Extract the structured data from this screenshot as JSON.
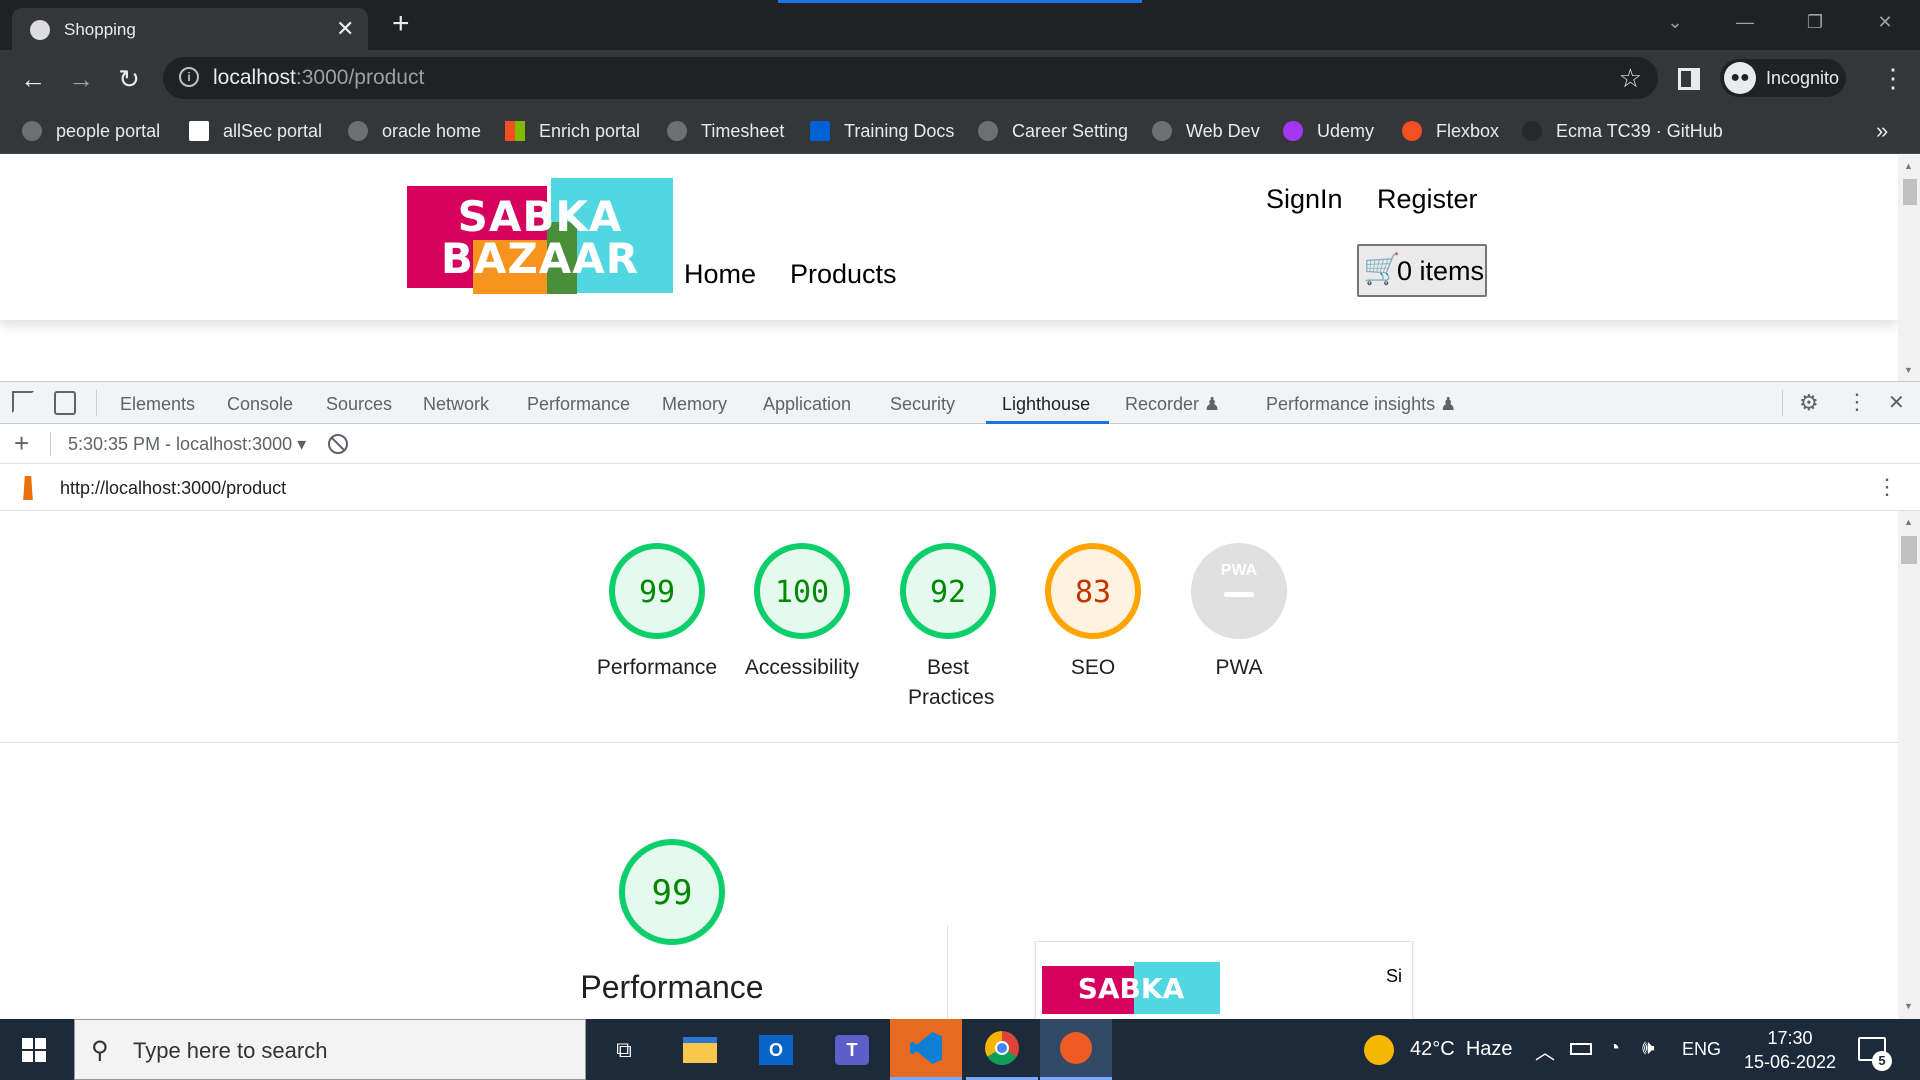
{
  "browser": {
    "tab_title": "Shopping",
    "url_host": "localhost",
    "url_path": ":3000/product",
    "profile_label": "Incognito",
    "bookmarks": [
      {
        "label": "people portal",
        "color": "#6e6f72"
      },
      {
        "label": "allSec portal",
        "color": "#ffffff"
      },
      {
        "label": "oracle home",
        "color": "#6e6f72"
      },
      {
        "label": "Enrich portal",
        "color": "#f25022"
      },
      {
        "label": "Timesheet",
        "color": "#6e6f72"
      },
      {
        "label": "Training Docs",
        "color": "#0061d5"
      },
      {
        "label": "Career Setting",
        "color": "#6e6f72"
      },
      {
        "label": "Web Dev",
        "color": "#6e6f72"
      },
      {
        "label": "Udemy",
        "color": "#a435f0"
      },
      {
        "label": "Flexbox",
        "color": "#f25022"
      },
      {
        "label": "Ecma TC39 · GitHub",
        "color": "#24292e"
      }
    ]
  },
  "site": {
    "logo_line1": "SABKA",
    "logo_line2": "BAZAAR",
    "nav_home": "Home",
    "nav_products": "Products",
    "signin": "SignIn",
    "register": "Register",
    "cart_label": "0 items",
    "colors": {
      "pink": "#d6005d",
      "orange": "#f7941e",
      "cyan": "#51d7e2",
      "green": "#4a8e3a",
      "cart": "#c8102e"
    }
  },
  "devtools": {
    "tabs": [
      {
        "label": "Elements"
      },
      {
        "label": "Console"
      },
      {
        "label": "Sources"
      },
      {
        "label": "Network"
      },
      {
        "label": "Performance"
      },
      {
        "label": "Memory"
      },
      {
        "label": "Application"
      },
      {
        "label": "Security"
      },
      {
        "label": "Lighthouse",
        "active": true
      },
      {
        "label": "Recorder"
      },
      {
        "label": "Performance insights"
      }
    ],
    "report_selector": "5:30:35 PM - localhost:3000",
    "report_url": "http://localhost:3000/product"
  },
  "lighthouse": {
    "scores": [
      {
        "label": "Performance",
        "value": 99,
        "status": "pass"
      },
      {
        "label": "Accessibility",
        "value": 100,
        "status": "pass"
      },
      {
        "label": "Best Practices",
        "value": 92,
        "status": "pass"
      },
      {
        "label": "SEO",
        "value": 83,
        "status": "average"
      },
      {
        "label": "PWA",
        "value": null,
        "status": "na"
      }
    ],
    "pwa_badge": "PWA",
    "main_score": 99,
    "main_label": "Performance",
    "preview_logo": "SABKA",
    "preview_link": "Si",
    "colors": {
      "pass": "#0cce6b",
      "pass_text": "#008800",
      "pass_bg": "#e6f9ee",
      "average": "#ffa400",
      "average_text": "#c33300",
      "average_bg": "#fff3e0",
      "na": "#e0e0e0"
    }
  },
  "taskbar": {
    "search_placeholder": "Type here to search",
    "weather_temp": "42°C",
    "weather_text": "Haze",
    "language": "ENG",
    "time": "17:30",
    "date": "15-06-2022",
    "notifications": "5"
  }
}
